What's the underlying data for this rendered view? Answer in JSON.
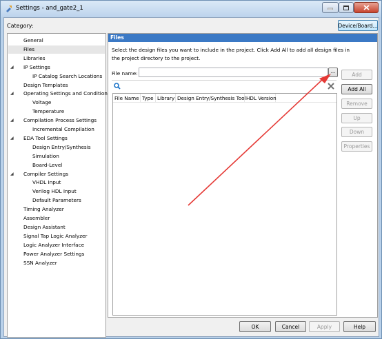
{
  "window": {
    "title": "Settings - and_gate2_1",
    "controls": [
      "minimize",
      "maximize",
      "close"
    ]
  },
  "category_label": "Category:",
  "device_board_button": "Device/Board...",
  "tree": [
    {
      "label": "General",
      "level": 0,
      "expander": false,
      "selected": false
    },
    {
      "label": "Files",
      "level": 0,
      "expander": false,
      "selected": true
    },
    {
      "label": "Libraries",
      "level": 0,
      "expander": false,
      "selected": false
    },
    {
      "label": "IP Settings",
      "level": 0,
      "expander": true,
      "selected": false
    },
    {
      "label": "IP Catalog Search Locations",
      "level": 1,
      "expander": false,
      "selected": false
    },
    {
      "label": "Design Templates",
      "level": 0,
      "expander": false,
      "selected": false
    },
    {
      "label": "Operating Settings and Conditions",
      "level": 0,
      "expander": true,
      "selected": false
    },
    {
      "label": "Voltage",
      "level": 1,
      "expander": false,
      "selected": false
    },
    {
      "label": "Temperature",
      "level": 1,
      "expander": false,
      "selected": false
    },
    {
      "label": "Compilation Process Settings",
      "level": 0,
      "expander": true,
      "selected": false
    },
    {
      "label": "Incremental Compilation",
      "level": 1,
      "expander": false,
      "selected": false
    },
    {
      "label": "EDA Tool Settings",
      "level": 0,
      "expander": true,
      "selected": false
    },
    {
      "label": "Design Entry/Synthesis",
      "level": 1,
      "expander": false,
      "selected": false
    },
    {
      "label": "Simulation",
      "level": 1,
      "expander": false,
      "selected": false
    },
    {
      "label": "Board-Level",
      "level": 1,
      "expander": false,
      "selected": false
    },
    {
      "label": "Compiler Settings",
      "level": 0,
      "expander": true,
      "selected": false
    },
    {
      "label": "VHDL Input",
      "level": 1,
      "expander": false,
      "selected": false
    },
    {
      "label": "Verilog HDL Input",
      "level": 1,
      "expander": false,
      "selected": false
    },
    {
      "label": "Default Parameters",
      "level": 1,
      "expander": false,
      "selected": false
    },
    {
      "label": "Timing Analyzer",
      "level": 0,
      "expander": false,
      "selected": false
    },
    {
      "label": "Assembler",
      "level": 0,
      "expander": false,
      "selected": false
    },
    {
      "label": "Design Assistant",
      "level": 0,
      "expander": false,
      "selected": false
    },
    {
      "label": "Signal Tap Logic Analyzer",
      "level": 0,
      "expander": false,
      "selected": false
    },
    {
      "label": "Logic Analyzer Interface",
      "level": 0,
      "expander": false,
      "selected": false
    },
    {
      "label": "Power Analyzer Settings",
      "level": 0,
      "expander": false,
      "selected": false
    },
    {
      "label": "SSN Analyzer",
      "level": 0,
      "expander": false,
      "selected": false
    }
  ],
  "files_panel": {
    "header": "Files",
    "description": "Select the design files you want to include in the project. Click Add All to add all design files in the project directory to the project.",
    "file_name_label": "File name:",
    "file_name_value": "",
    "browse_label": "...",
    "columns": [
      "File Name",
      "Type",
      "Library",
      "Design Entry/Synthesis Tool",
      "HDL Version"
    ],
    "rows": []
  },
  "side_buttons": [
    {
      "label": "Add",
      "enabled": false
    },
    {
      "label": "Add All",
      "enabled": true
    },
    {
      "label": "Remove",
      "enabled": false
    },
    {
      "label": "Up",
      "enabled": false
    },
    {
      "label": "Down",
      "enabled": false
    },
    {
      "label": "Properties",
      "enabled": false
    }
  ],
  "bottom_buttons": [
    {
      "label": "OK",
      "enabled": true
    },
    {
      "label": "Cancel",
      "enabled": true
    },
    {
      "label": "Apply",
      "enabled": false
    },
    {
      "label": "Help",
      "enabled": true
    }
  ],
  "colors": {
    "header_blue": "#3b79c5",
    "annotation_arrow": "#e53935"
  }
}
